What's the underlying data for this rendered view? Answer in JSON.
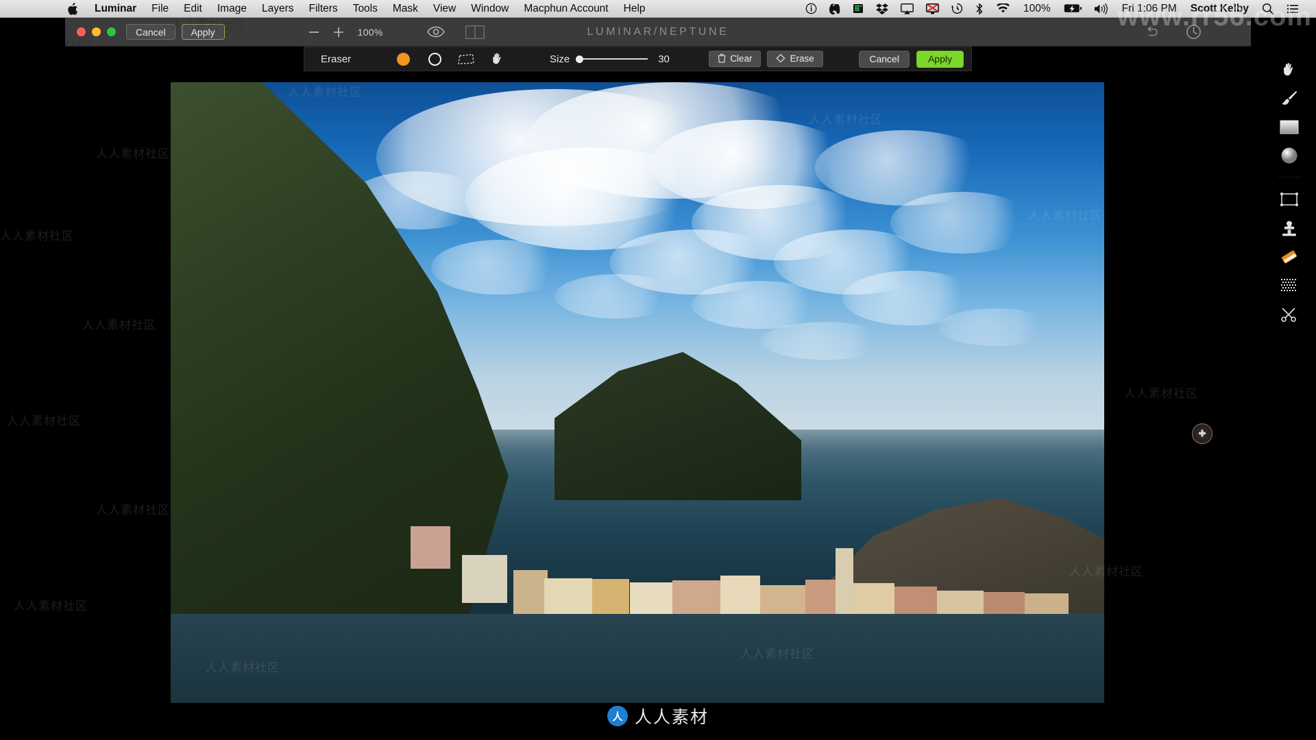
{
  "menubar": {
    "apple_icon": "apple-logo-icon",
    "items": [
      {
        "label": "Luminar",
        "bold": true
      },
      {
        "label": "File",
        "bold": false
      },
      {
        "label": "Edit",
        "bold": false
      },
      {
        "label": "Image",
        "bold": false
      },
      {
        "label": "Layers",
        "bold": false
      },
      {
        "label": "Filters",
        "bold": false
      },
      {
        "label": "Tools",
        "bold": false
      },
      {
        "label": "Mask",
        "bold": false
      },
      {
        "label": "View",
        "bold": false
      },
      {
        "label": "Window",
        "bold": false
      },
      {
        "label": "Macphun Account",
        "bold": false
      },
      {
        "label": "Help",
        "bold": false
      }
    ],
    "status_icons": [
      "info-circle-icon",
      "evernote-icon",
      "backup-drive-icon",
      "dropbox-icon",
      "airplay-icon",
      "display-off-icon",
      "time-machine-icon",
      "bluetooth-icon",
      "wifi-icon"
    ],
    "battery_percent": "100%",
    "battery_icon": "battery-charging-icon",
    "volume_icon": "volume-icon",
    "clock": "Fri 1:06 PM",
    "user": "Scott Kelby",
    "search_icon": "search-icon",
    "notification_icon": "notification-center-icon"
  },
  "window": {
    "traffic_lights": [
      "close-button",
      "minimize-button",
      "zoom-button"
    ],
    "cancel_label": "Cancel",
    "apply_label": "Apply",
    "zoom_out_icon": "minus-icon",
    "zoom_in_icon": "plus-icon",
    "zoom_value": "100%",
    "compare_icon": "eye-icon",
    "split_view_icon": "split-view-icon",
    "title": "LUMINAR/NEPTUNE",
    "undo_icon": "undo-icon",
    "history_icon": "check-circle-icon"
  },
  "eraser_toolbar": {
    "title": "Eraser",
    "tools": [
      {
        "name": "brush-color-swatch",
        "icon": "orange-dot-icon"
      },
      {
        "name": "brush-outline",
        "icon": "white-ring-icon"
      },
      {
        "name": "lasso-tool",
        "icon": "lasso-icon"
      },
      {
        "name": "hand-tool",
        "icon": "hand-icon"
      }
    ],
    "size_label": "Size",
    "size_value": "30",
    "size_percent": 3,
    "clear_label": "Clear",
    "clear_icon": "trash-icon",
    "erase_label": "Erase",
    "erase_icon": "eraser-icon",
    "cancel_label": "Cancel",
    "apply_label": "Apply",
    "apply_color": "#7dd62a"
  },
  "tool_rail": {
    "items": [
      {
        "name": "hand-tool",
        "icon": "hand-icon",
        "selected": false
      },
      {
        "name": "brush-tool",
        "icon": "brush-icon",
        "selected": false
      },
      {
        "name": "gradient-mask-tool",
        "icon": "gradient-icon",
        "selected": false
      },
      {
        "name": "radial-mask-tool",
        "icon": "radial-gradient-icon",
        "selected": false
      },
      {
        "name": "transform-tool",
        "icon": "transform-icon",
        "selected": false
      },
      {
        "name": "clone-stamp-tool",
        "icon": "clone-stamp-icon",
        "selected": false
      },
      {
        "name": "eraser-tool",
        "icon": "eraser-icon",
        "selected": true
      },
      {
        "name": "denoise-tool",
        "icon": "dither-icon",
        "selected": false
      },
      {
        "name": "scissors-tool",
        "icon": "scissors-icon",
        "selected": false
      }
    ],
    "cursor_badge": "brush-cursor-icon"
  },
  "photo": {
    "name": "vernazza-cinque-terre-photo",
    "description": "Coastal Italian village on a hillside with dramatic cloudy blue sky over the sea"
  },
  "watermark": {
    "site": "www.rr56.com",
    "brand": "人人素材",
    "tiles": [
      "人人素材社区",
      "人人素材社区",
      "人人素材社区",
      "人人素材社区",
      "人人素材社区",
      "人人素材社区",
      "人人素材社区",
      "人人素材社区",
      "人人素材社区",
      "人人素材社区",
      "人人素材社区",
      "人人素材社区",
      "人人素材社区",
      "人人素材社区",
      "人人素材社区",
      "人人素材社区"
    ]
  }
}
